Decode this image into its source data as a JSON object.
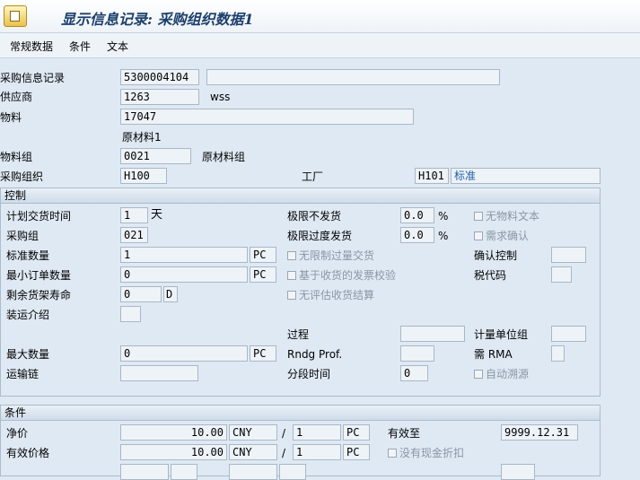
{
  "window": {
    "title": "显示信息记录: 采购组织数据1"
  },
  "menu": {
    "items": [
      "常规数据",
      "条件",
      "文本"
    ]
  },
  "header": {
    "info_record_label": "采购信息记录",
    "info_record_value": "5300004104",
    "vendor_label": "供应商",
    "vendor_value": "1263",
    "vendor_name": "wss",
    "material_label": "物料",
    "material_value": "17047",
    "material_desc": "原材料1",
    "material_group_label": "物料组",
    "material_group_value": "0021",
    "material_group_desc": "原材料组",
    "purch_org_label": "采购组织",
    "purch_org_value": "H100",
    "plant_label": "工厂",
    "plant_value": "H101",
    "plant_desc": "标准"
  },
  "control": {
    "title": "控制",
    "planned_delivery_label": "计划交货时间",
    "planned_delivery_value": "1",
    "planned_delivery_unit": "天",
    "purch_group_label": "采购组",
    "purch_group_value": "021",
    "standard_qty_label": "标准数量",
    "standard_qty_value": "1",
    "standard_qty_unit": "PC",
    "min_order_label": "最小订单数量",
    "min_order_value": "0",
    "min_order_unit": "PC",
    "shelf_life_label": "剩余货架寿命",
    "shelf_life_value": "0",
    "shelf_life_unit": "D",
    "shipping_instr_label": "装运介绍",
    "underdel_label": "极限不发货",
    "underdel_value": "0.0",
    "underdel_unit": "%",
    "overdel_label": "极限过度发货",
    "overdel_value": "0.0",
    "overdel_unit": "%",
    "unlimited_label": "无限制过量交货",
    "gr_based_iv_label": "基于收货的发票校验",
    "no_ers_label": "无评估收货结算",
    "no_mat_text_label": "无物料文本",
    "ack_reqd_label": "需求确认",
    "conf_control_label": "确认控制",
    "tax_code_label": "税代码",
    "process_label": "过程",
    "rndg_label": "Rndg Prof.",
    "period_label": "分段时间",
    "period_value": "0",
    "uom_group_label": "计量单位组",
    "rma_label": "需 RMA",
    "auto_source_label": "自动溯源",
    "max_qty_label": "最大数量",
    "max_qty_value": "0",
    "max_qty_unit": "PC",
    "transport_chain_label": "运输链"
  },
  "conditions": {
    "title": "条件",
    "net_price_label": "净价",
    "net_price_value": "10.00",
    "net_price_currency": "CNY",
    "net_price_per": "1",
    "net_price_unit": "PC",
    "slash": "/",
    "valid_to_label": "有效至",
    "valid_to_value": "9999.12.31",
    "eff_price_label": "有效价格",
    "eff_price_value": "10.00",
    "eff_price_currency": "CNY",
    "eff_price_per": "1",
    "eff_price_unit": "PC",
    "no_cash_disc_label": "没有现金折扣"
  }
}
